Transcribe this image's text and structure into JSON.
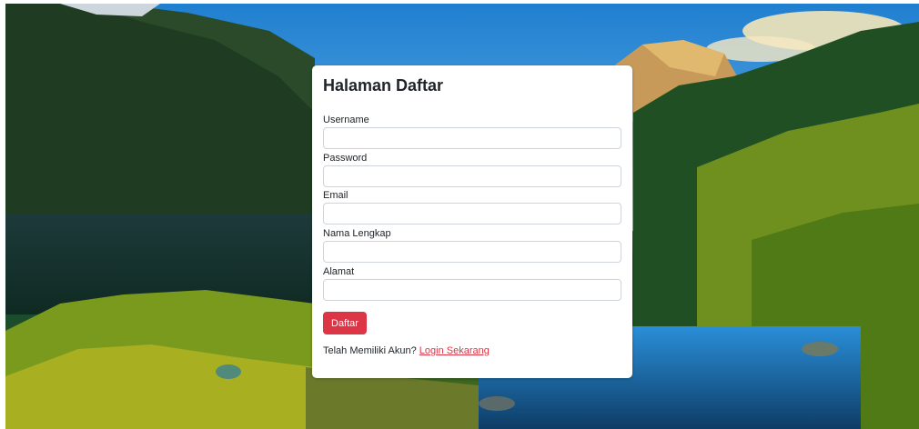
{
  "form": {
    "title": "Halaman Daftar",
    "fields": [
      {
        "label": "Username",
        "value": "",
        "placeholder": ""
      },
      {
        "label": "Password",
        "value": "",
        "placeholder": ""
      },
      {
        "label": "Email",
        "value": "",
        "placeholder": ""
      },
      {
        "label": "Nama Lengkap",
        "value": "",
        "placeholder": ""
      },
      {
        "label": "Alamat",
        "value": "",
        "placeholder": ""
      }
    ],
    "submit_label": "Daftar",
    "footer_text": "Telah Memiliki Akun?",
    "login_link": "Login Sekarang"
  },
  "colors": {
    "accent": "#dc3545",
    "card_bg": "#ffffff"
  }
}
